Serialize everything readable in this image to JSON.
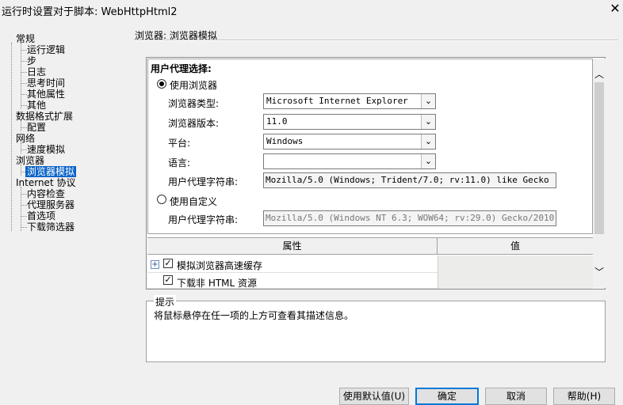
{
  "window": {
    "title": "运行时设置对于脚本: WebHttpHtml2",
    "close_glyph": "✕"
  },
  "tree": {
    "items": [
      {
        "label": "常规",
        "level": 0
      },
      {
        "label": "运行逻辑",
        "level": 1
      },
      {
        "label": "步",
        "level": 1
      },
      {
        "label": "日志",
        "level": 1
      },
      {
        "label": "思考时间",
        "level": 1
      },
      {
        "label": "其他属性",
        "level": 1
      },
      {
        "label": "其他",
        "level": 1
      },
      {
        "label": "数据格式扩展",
        "level": 0
      },
      {
        "label": "配置",
        "level": 1
      },
      {
        "label": "网络",
        "level": 0
      },
      {
        "label": "速度模拟",
        "level": 1
      },
      {
        "label": "浏览器",
        "level": 0
      },
      {
        "label": "浏览器模拟",
        "level": 1,
        "selected": true
      },
      {
        "label": "Internet 协议",
        "level": 0
      },
      {
        "label": "内容检查",
        "level": 1
      },
      {
        "label": "代理服务器",
        "level": 1
      },
      {
        "label": "首选项",
        "level": 1
      },
      {
        "label": "下载筛选器",
        "level": 1
      }
    ]
  },
  "section": {
    "title": "浏览器: 浏览器模拟"
  },
  "ua": {
    "heading": "用户代理选择:",
    "use_browser": {
      "label": "使用浏览器",
      "checked": true,
      "browser_type_label": "浏览器类型:",
      "browser_type_value": "Microsoft Internet Explorer",
      "browser_version_label": "浏览器版本:",
      "browser_version_value": "11.0",
      "platform_label": "平台:",
      "platform_value": "Windows",
      "language_label": "语言:",
      "language_value": "",
      "ua_string_label": "用户代理字符串:",
      "ua_string_value": "Mozilla/5.0 (Windows; Trident/7.0; rv:11.0) like Gecko"
    },
    "use_custom": {
      "label": "使用自定义",
      "checked": false,
      "ua_string_label": "用户代理字符串:",
      "ua_string_value": "Mozilla/5.0 (Windows NT 6.3; WOW64; rv:29.0) Gecko/2010"
    }
  },
  "grid": {
    "col_property": "属性",
    "col_value": "值",
    "rows": [
      {
        "label": "模拟浏览器高速缓存",
        "checked": true,
        "expandable": true
      },
      {
        "label": "下载非 HTML 资源",
        "checked": true,
        "expandable": false
      }
    ]
  },
  "hint": {
    "title": "提示",
    "text": "将鼠标悬停在任一项的上方可查看其描述信息。"
  },
  "buttons": {
    "use_defaults": "使用默认值(U)",
    "ok": "确定",
    "cancel": "取消",
    "help": "帮助(H)"
  },
  "colors": {
    "selection": "#0a64c8",
    "default_button_border": "#0078d7"
  }
}
